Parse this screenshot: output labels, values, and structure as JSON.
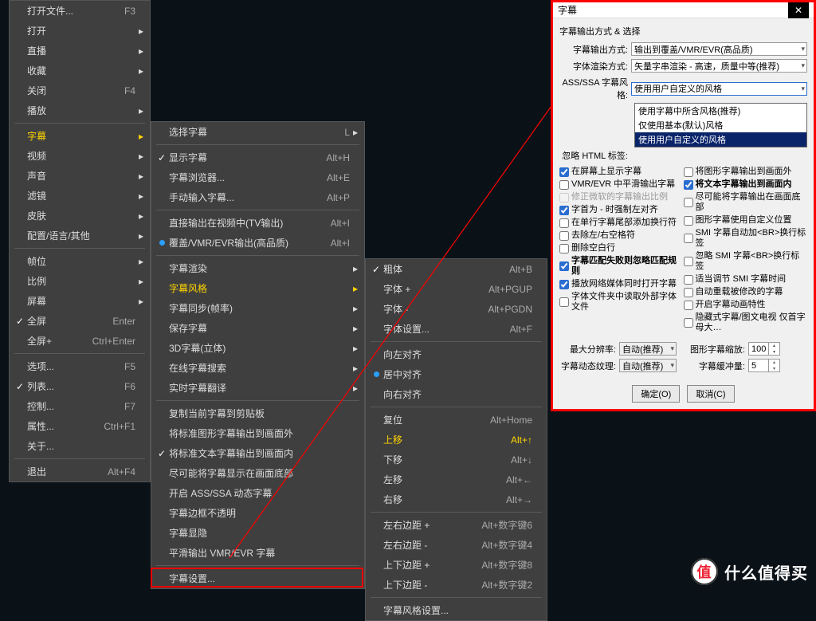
{
  "menu1": {
    "items": [
      {
        "chk": "",
        "label": "打开文件...",
        "sc": "F3",
        "arrow": false
      },
      {
        "chk": "",
        "label": "打开",
        "sc": "",
        "arrow": true
      },
      {
        "chk": "",
        "label": "直播",
        "sc": "",
        "arrow": true
      },
      {
        "chk": "",
        "label": "收藏",
        "sc": "",
        "arrow": true
      },
      {
        "chk": "",
        "label": "关闭",
        "sc": "F4",
        "arrow": false
      },
      {
        "chk": "",
        "label": "播放",
        "sc": "",
        "arrow": true
      },
      {
        "chk": "",
        "label": "字幕",
        "sc": "",
        "arrow": true,
        "hl": true,
        "sep_before": true
      },
      {
        "chk": "",
        "label": "视频",
        "sc": "",
        "arrow": true
      },
      {
        "chk": "",
        "label": "声音",
        "sc": "",
        "arrow": true
      },
      {
        "chk": "",
        "label": "滤镜",
        "sc": "",
        "arrow": true
      },
      {
        "chk": "",
        "label": "皮肤",
        "sc": "",
        "arrow": true
      },
      {
        "chk": "",
        "label": "配置/语言/其他",
        "sc": "",
        "arrow": true
      },
      {
        "chk": "",
        "label": "帧位",
        "sc": "",
        "arrow": true,
        "sep_before": true
      },
      {
        "chk": "",
        "label": "比例",
        "sc": "",
        "arrow": true
      },
      {
        "chk": "",
        "label": "屏幕",
        "sc": "",
        "arrow": true
      },
      {
        "chk": "✓",
        "label": "全屏",
        "sc": "Enter",
        "arrow": false
      },
      {
        "chk": "",
        "label": "全屏+",
        "sc": "Ctrl+Enter",
        "arrow": false
      },
      {
        "chk": "",
        "label": "选项...",
        "sc": "F5",
        "arrow": false,
        "sep_before": true
      },
      {
        "chk": "✓",
        "label": "列表...",
        "sc": "F6",
        "arrow": false
      },
      {
        "chk": "",
        "label": "控制...",
        "sc": "F7",
        "arrow": false
      },
      {
        "chk": "",
        "label": "属性...",
        "sc": "Ctrl+F1",
        "arrow": false
      },
      {
        "chk": "",
        "label": "关于...",
        "sc": "",
        "arrow": false
      },
      {
        "chk": "",
        "label": "退出",
        "sc": "Alt+F4",
        "arrow": false,
        "sep_before": true
      }
    ]
  },
  "menu2": {
    "items": [
      {
        "label": "选择字幕",
        "sc": "L",
        "arrow": true
      },
      {
        "chk": "✓",
        "label": "显示字幕",
        "sc": "Alt+H",
        "sep_before": true
      },
      {
        "label": "字幕浏览器...",
        "sc": "Alt+E"
      },
      {
        "label": "手动输入字幕...",
        "sc": "Alt+P"
      },
      {
        "label": "直接输出在视频中(TV输出)",
        "sc": "Alt+I",
        "sep_before": true
      },
      {
        "radio": true,
        "label": "覆盖/VMR/EVR输出(高品质)",
        "sc": "Alt+I"
      },
      {
        "label": "字幕渲染",
        "arrow": true,
        "sep_before": true
      },
      {
        "label": "字幕风格",
        "arrow": true,
        "hl": true
      },
      {
        "label": "字幕同步(帧率)",
        "arrow": true
      },
      {
        "label": "保存字幕",
        "arrow": true
      },
      {
        "label": "3D字幕(立体)",
        "arrow": true
      },
      {
        "label": "在线字幕搜索",
        "arrow": true
      },
      {
        "label": "实时字幕翻译",
        "arrow": true
      },
      {
        "label": "复制当前字幕到剪贴板",
        "sep_before": true
      },
      {
        "label": "将标准图形字幕输出到画面外"
      },
      {
        "chk": "✓",
        "label": "将标准文本字幕输出到画面内"
      },
      {
        "label": "尽可能将字幕显示在画面底部"
      },
      {
        "label": "开启 ASS/SSA 动态字幕"
      },
      {
        "label": "字幕边框不透明"
      },
      {
        "label": "字幕显隐"
      },
      {
        "label": "平滑输出 VMR/EVR 字幕"
      },
      {
        "label": "字幕设置...",
        "sep_before": true,
        "redbox": true
      }
    ]
  },
  "menu3": {
    "items": [
      {
        "chk": "✓",
        "label": "粗体",
        "sc": "Alt+B"
      },
      {
        "label": "字体 +",
        "sc": "Alt+PGUP"
      },
      {
        "label": "字体 -",
        "sc": "Alt+PGDN"
      },
      {
        "label": "字体设置...",
        "sc": "Alt+F"
      },
      {
        "label": "向左对齐",
        "sep_before": true
      },
      {
        "radio": true,
        "label": "居中对齐"
      },
      {
        "label": "向右对齐"
      },
      {
        "label": "复位",
        "sc": "Alt+Home",
        "sep_before": true
      },
      {
        "label": "上移",
        "sc": "Alt+↑",
        "hl": true
      },
      {
        "label": "下移",
        "sc": "Alt+↓"
      },
      {
        "label": "左移",
        "sc": "Alt+←"
      },
      {
        "label": "右移",
        "sc": "Alt+→"
      },
      {
        "label": "左右边距 +",
        "sc": "Alt+数字键6",
        "sep_before": true
      },
      {
        "label": "左右边距 -",
        "sc": "Alt+数字键4"
      },
      {
        "label": "上下边距 +",
        "sc": "Alt+数字键8"
      },
      {
        "label": "上下边距 -",
        "sc": "Alt+数字键2"
      },
      {
        "label": "字幕风格设置...",
        "sep_before": true
      }
    ]
  },
  "dialog": {
    "title": "字幕",
    "section": "字幕输出方式 & 选择",
    "rows": [
      {
        "l": "字幕输出方式:",
        "v": "输出到覆盖/VMR/EVR(高品质)"
      },
      {
        "l": "字体渲染方式:",
        "v": "矢量字串渲染 - 高速，质量中等(推荐)"
      },
      {
        "l": "ASS/SSA 字幕风格:",
        "v": "使用用户自定义的风格",
        "open": true
      },
      {
        "l": "忽略 HTML 标签:",
        "v": ""
      }
    ],
    "dropdown": [
      "使用字幕中所含风格(推荐)",
      "仅使用基本(默认)风格",
      "使用用户自定义的风格"
    ],
    "checks_left": [
      {
        "t": "在屏幕上显示字幕",
        "c": true
      },
      {
        "t": "VMR/EVR 中平滑输出字幕",
        "c": false
      },
      {
        "t": "修正微软的字幕输出比例",
        "c": false,
        "grey": true
      },
      {
        "t": "字首为 - 时强制左对齐",
        "c": true
      },
      {
        "t": "在单行字幕尾部添加换行符",
        "c": false
      },
      {
        "t": "去除左/右空格符",
        "c": false
      },
      {
        "t": "删除空白行",
        "c": false
      },
      {
        "t": "字幕匹配失败则忽略匹配规则",
        "c": true,
        "bold": true
      },
      {
        "t": "播放网络媒体同时打开字幕",
        "c": true
      },
      {
        "t": "字体文件夹中读取外部字体文件",
        "c": false
      }
    ],
    "checks_right": [
      {
        "t": "将图形字幕输出到画面外",
        "c": false
      },
      {
        "t": "将文本字幕输出到画面内",
        "c": true,
        "bold": true
      },
      {
        "t": "尽可能将字幕输出在画面底部",
        "c": false
      },
      {
        "t": "图形字幕使用自定义位置",
        "c": false
      },
      {
        "t": "SMI 字幕自动加<BR>换行标签",
        "c": false
      },
      {
        "t": "忽略 SMI 字幕<BR>换行标签",
        "c": false
      },
      {
        "t": "适当调节 SMI 字幕时间",
        "c": false
      },
      {
        "t": "自动重载被修改的字幕",
        "c": false
      },
      {
        "t": "开启字幕动画特性",
        "c": false
      },
      {
        "t": "隐藏式字幕/图文电视 仅首字母大…",
        "c": false
      }
    ],
    "bottom": {
      "res_l": "最大分辨率:",
      "res_v": "自动(推荐)",
      "scale_l": "图形字幕缩放:",
      "scale_v": "100",
      "tex_l": "字幕动态纹理:",
      "tex_v": "自动(推荐)",
      "buf_l": "字幕缓冲量:",
      "buf_v": "5"
    },
    "ok": "确定(O)",
    "cancel": "取消(C)"
  },
  "watermark": "什么值得买",
  "watermark_badge": "值"
}
